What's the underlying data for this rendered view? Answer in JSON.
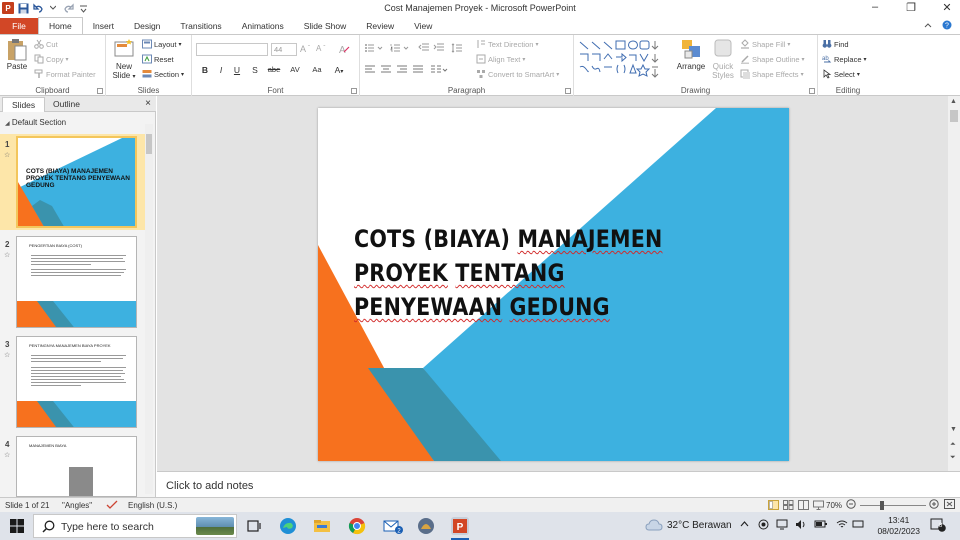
{
  "window": {
    "title": "Cost Manajemen Proyek  -  Microsoft PowerPoint",
    "controls": [
      "–",
      "❐",
      "✕"
    ]
  },
  "tabs": [
    "File",
    "Home",
    "Insert",
    "Design",
    "Transitions",
    "Animations",
    "Slide Show",
    "Review",
    "View"
  ],
  "ribbon": {
    "clipboard": {
      "label": "Clipboard",
      "paste": "Paste",
      "cut": "Cut",
      "copy": "Copy",
      "format_painter": "Format Painter"
    },
    "slides": {
      "label": "Slides",
      "new_slide": "New Slide",
      "layout": "Layout",
      "reset": "Reset",
      "section": "Section"
    },
    "font": {
      "label": "Font",
      "size": "44",
      "bold": "B",
      "italic": "I",
      "underline": "U",
      "strike": "S",
      "abc": "abe",
      "spacing": "AV",
      "case": "Aa",
      "color": "A"
    },
    "paragraph": {
      "label": "Paragraph",
      "text_direction": "Text Direction",
      "align_text": "Align Text",
      "smartart": "Convert to SmartArt"
    },
    "drawing": {
      "label": "Drawing",
      "arrange": "Arrange",
      "quick_styles": "Quick Styles",
      "shape_fill": "Shape Fill",
      "shape_outline": "Shape Outline",
      "shape_effects": "Shape Effects"
    },
    "editing": {
      "label": "Editing",
      "find": "Find",
      "replace": "Replace",
      "select": "Select"
    }
  },
  "panel": {
    "tabs": [
      "Slides",
      "Outline"
    ],
    "close": "×",
    "section": "Default Section",
    "thumbnails": [
      {
        "num": "1",
        "title": "COTS (BIAYA)  MANAJEMEN PROYEK  TENTANG  PENYEWAAN GEDUNG"
      },
      {
        "num": "2",
        "title": "PENGERTIAN BIAYA (COST)"
      },
      {
        "num": "3",
        "title": "PENTINGNYA MANAJEMEN BIAYA PROYEK"
      },
      {
        "num": "4",
        "title": "MANAJEMEN BIAYA"
      }
    ]
  },
  "slide": {
    "title_parts": [
      "COTS (BIAYA) ",
      "MANAJEMEN",
      " ",
      "PROYEK",
      " ",
      "TENTANG",
      " ",
      "PENYEWAAN",
      " ",
      "GEDUNG"
    ],
    "colors": {
      "blue": "#3db1e0",
      "orange": "#f7711e",
      "teal": "#3a93ad"
    }
  },
  "notes": {
    "placeholder": "Click to add notes"
  },
  "status": {
    "slide_of": "Slide 1 of 21",
    "theme": "\"Angles\"",
    "language": "English (U.S.)",
    "zoom": "70%"
  },
  "taskbar": {
    "search": "Type here to search",
    "weather": "32°C  Berawan",
    "time": "13:41",
    "date": "08/02/2023",
    "notif": "8"
  }
}
